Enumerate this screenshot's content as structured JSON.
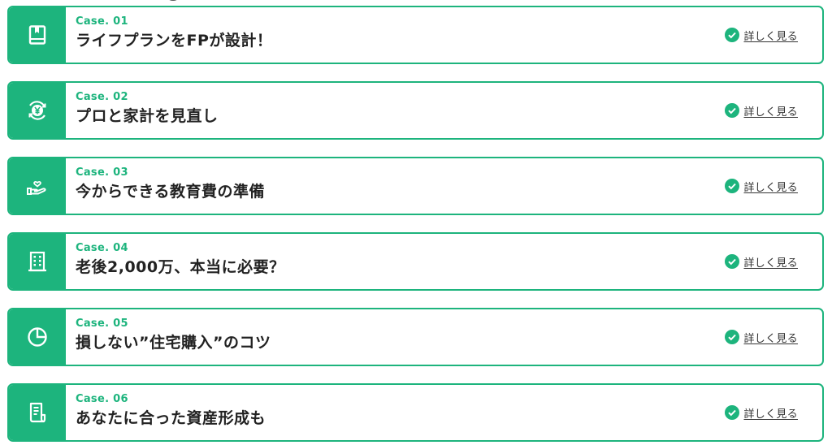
{
  "cases": [
    {
      "label": "Case. 01",
      "title": "ライフプランをFPが設計！",
      "more": "詳しく見る",
      "icon": "book-icon"
    },
    {
      "label": "Case. 02",
      "title": "プロと家計を見直し",
      "more": "詳しく見る",
      "icon": "yen-cycle-icon"
    },
    {
      "label": "Case. 03",
      "title": "今からできる教育費の準備",
      "more": "詳しく見る",
      "icon": "hand-heart-icon"
    },
    {
      "label": "Case. 04",
      "title": "老後2,000万、本当に必要？",
      "more": "詳しく見る",
      "icon": "building-icon"
    },
    {
      "label": "Case. 05",
      "title": "損しない”住宅購入”のコツ",
      "more": "詳しく見る",
      "icon": "pie-chart-icon"
    },
    {
      "label": "Case. 06",
      "title": "あなたに合った資産形成も",
      "more": "詳しく見る",
      "icon": "document-icon"
    }
  ],
  "colors": {
    "accent": "#1db47d",
    "text": "#222222",
    "link": "#333333"
  }
}
